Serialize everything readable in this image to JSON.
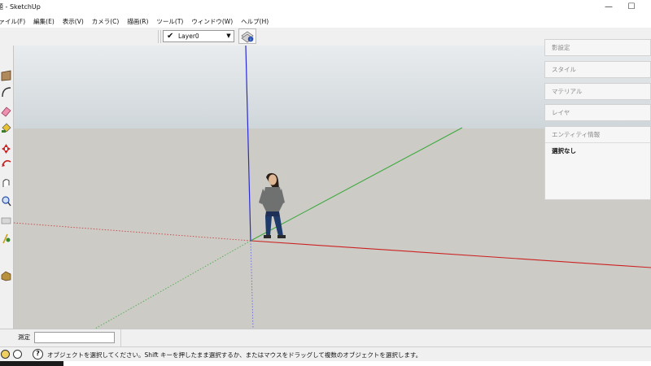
{
  "window": {
    "title": "無題 - SketchUp",
    "minimize_glyph": "—",
    "maximize_glyph": "☐"
  },
  "menu": {
    "items": [
      "ファイル(F)",
      "編集(E)",
      "表示(V)",
      "カメラ(C)",
      "描画(R)",
      "ツール(T)",
      "ウィンドウ(W)",
      "ヘルプ(H)"
    ]
  },
  "toolbar": {
    "layer_check": "✔",
    "layer_name": "Layer0",
    "layer_arrow": "▼"
  },
  "tray": {
    "panels": [
      "影設定",
      "スタイル",
      "マテリアル",
      "レイヤ"
    ],
    "entity_info_title": "エンティティ情報",
    "entity_info_value": "選択なし"
  },
  "measurements": {
    "label": "測定",
    "value": ""
  },
  "status": {
    "help_glyph": "?",
    "message": "オブジェクトを選択してください。Shift キーを押したまま選択するか、またはマウスをドラッグして複数のオブジェクトを選択します。"
  },
  "icons": {
    "left_tools": [
      "rectangle-tool-icon",
      "arc-tool-icon",
      "eraser-tool-icon",
      "paint-bucket-tool-icon",
      "move-tool-icon",
      "rotate-tool-icon",
      "orbit-tool-icon",
      "pan-tool-icon",
      "zoom-tool-icon",
      "zoom-extents-tool-icon",
      "walk-tool-icon",
      "tape-measure-icon",
      "warehouse-icon"
    ]
  },
  "colors": {
    "axis_red": "#cc2222",
    "axis_green": "#3faa3f",
    "axis_blue": "#2a2ad6",
    "sky_top": "#e9ecee",
    "ground": "#cccbc6"
  }
}
